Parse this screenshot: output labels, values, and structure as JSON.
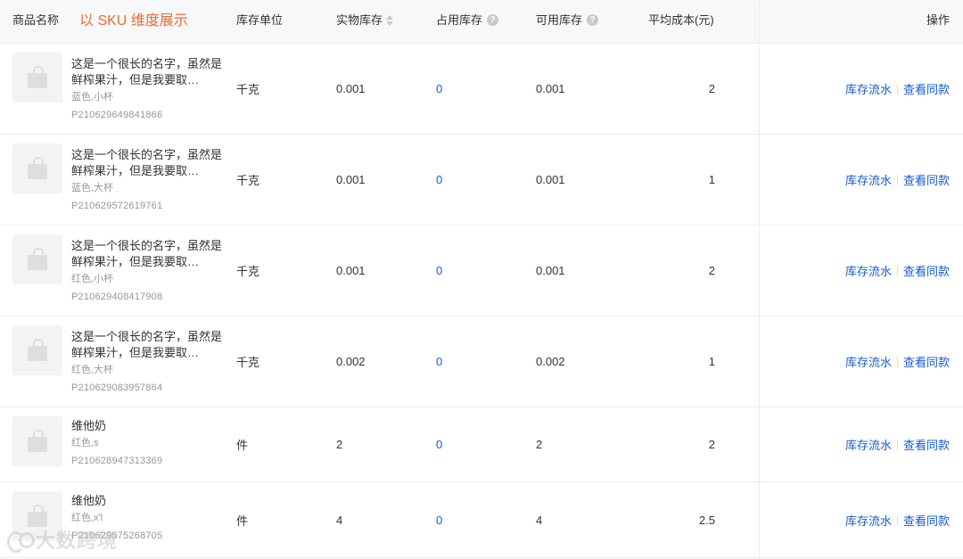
{
  "header": {
    "product_name": "商品名称",
    "note": "以 SKU 维度展示",
    "unit": "库存单位",
    "physical_stock": "实物库存",
    "occupied_stock": "占用库存",
    "available_stock": "可用库存",
    "avg_cost": "平均成本(元)",
    "actions": "操作",
    "help_glyph": "?"
  },
  "rows": [
    {
      "name": "这是一个很长的名字，虽然是鲜榨果汁，但是我要取…",
      "spec": "蓝色,小杯",
      "code": "P210629649841866",
      "unit": "千克",
      "physical": "0.001",
      "occupied": "0",
      "available": "0.001",
      "cost": "2",
      "action_flow": "库存流水",
      "action_same": "查看同款"
    },
    {
      "name": "这是一个很长的名字，虽然是鲜榨果汁，但是我要取…",
      "spec": "蓝色,大杯",
      "code": "P210629572619761",
      "unit": "千克",
      "physical": "0.001",
      "occupied": "0",
      "available": "0.001",
      "cost": "1",
      "action_flow": "库存流水",
      "action_same": "查看同款"
    },
    {
      "name": "这是一个很长的名字，虽然是鲜榨果汁，但是我要取…",
      "spec": "红色,小杯",
      "code": "P210629408417908",
      "unit": "千克",
      "physical": "0.001",
      "occupied": "0",
      "available": "0.001",
      "cost": "2",
      "action_flow": "库存流水",
      "action_same": "查看同款"
    },
    {
      "name": "这是一个很长的名字，虽然是鲜榨果汁，但是我要取…",
      "spec": "红色,大杯",
      "code": "P210629083957864",
      "unit": "千克",
      "physical": "0.002",
      "occupied": "0",
      "available": "0.002",
      "cost": "1",
      "action_flow": "库存流水",
      "action_same": "查看同款"
    },
    {
      "name": "维他奶",
      "spec": "红色,s",
      "code": "P210628947313369",
      "unit": "件",
      "physical": "2",
      "occupied": "0",
      "available": "2",
      "cost": "2",
      "action_flow": "库存流水",
      "action_same": "查看同款"
    },
    {
      "name": "维他奶",
      "spec": "红色,x'l",
      "code": "P210629575268705",
      "unit": "件",
      "physical": "4",
      "occupied": "0",
      "available": "4",
      "cost": "2.5",
      "action_flow": "库存流水",
      "action_same": "查看同款"
    }
  ],
  "watermark": {
    "text": "大数跨境"
  },
  "colors": {
    "link": "#155bd4",
    "note": "#ee6a34",
    "header_bg": "#f7f8fa"
  },
  "icons": {
    "sort": "sort-caret-icon",
    "help": "help-circle-icon",
    "thumb": "shopping-bag-icon"
  }
}
